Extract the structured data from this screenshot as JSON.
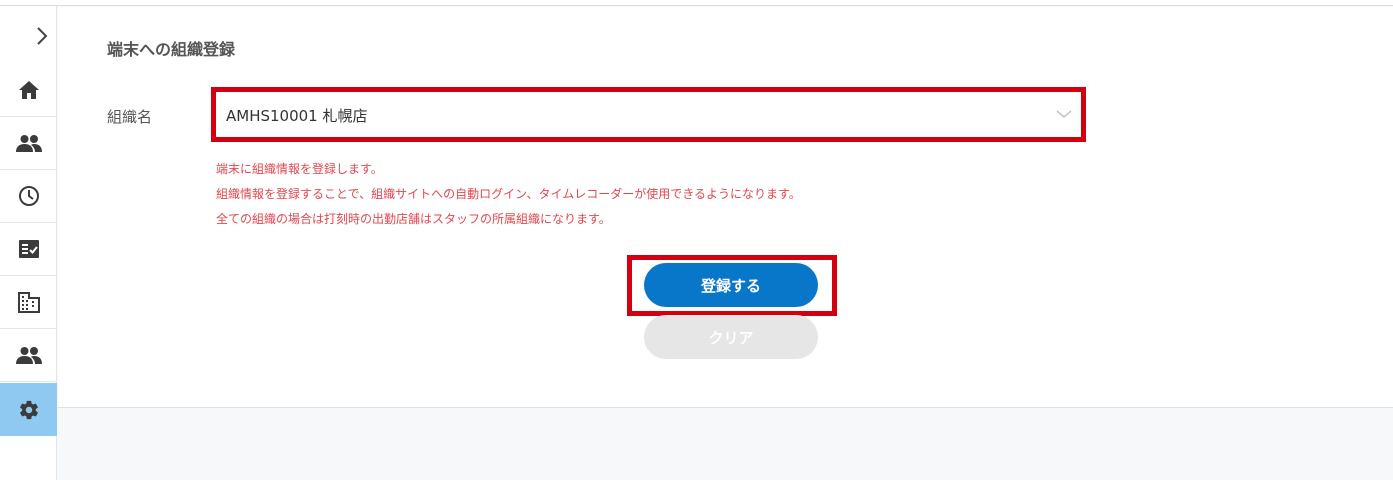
{
  "colors": {
    "accent": "#0877c9",
    "highlight_border": "#d4000f",
    "note_text": "#e0484f",
    "sidebar_active": "#8fc9f1",
    "clear_button": "#e6e6e6"
  },
  "sidebar": {
    "toggle_icon": "chevron-right-icon",
    "items": [
      {
        "icon": "home-icon",
        "active": false
      },
      {
        "icon": "people-icon",
        "active": false
      },
      {
        "icon": "clock-icon",
        "active": false
      },
      {
        "icon": "checklist-icon",
        "active": false
      },
      {
        "icon": "building-icon",
        "active": false
      },
      {
        "icon": "people-icon",
        "active": false
      },
      {
        "icon": "gear-icon",
        "active": true
      }
    ]
  },
  "form": {
    "title": "端末への組織登録",
    "org_label": "組織名",
    "org_select": {
      "value": "AMHS10001 札幌店"
    },
    "notes": [
      "端末に組織情報を登録します。",
      "組織情報を登録することで、組織サイトへの自動ログイン、タイムレコーダーが使用できるようになります。",
      "全ての組織の場合は打刻時の出勤店舗はスタッフの所属組織になります。"
    ],
    "register_button": "登録する",
    "clear_button": "クリア"
  }
}
